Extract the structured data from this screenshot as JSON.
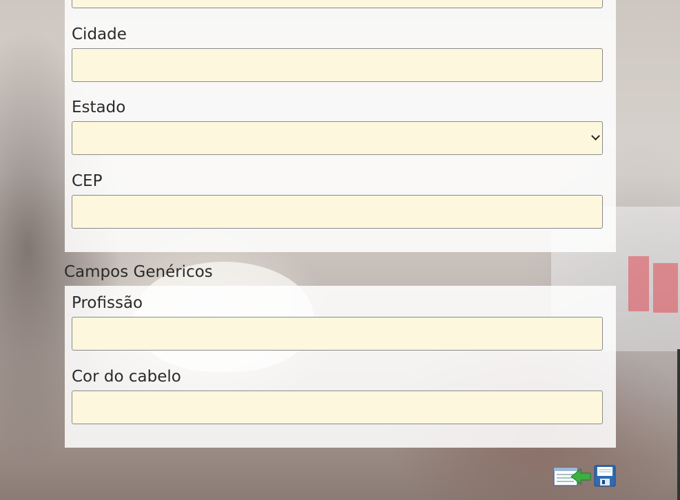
{
  "address_section": {
    "fields": {
      "cidade": {
        "label": "Cidade",
        "value": "",
        "placeholder": ""
      },
      "estado": {
        "label": "Estado",
        "value": ""
      },
      "cep": {
        "label": "CEP",
        "value": "",
        "placeholder": ""
      }
    }
  },
  "generic_section": {
    "title": "Campos Genéricos",
    "fields": {
      "profissao": {
        "label": "Profissão",
        "value": "",
        "placeholder": ""
      },
      "cor_cabelo": {
        "label": "Cor do cabelo",
        "value": "",
        "placeholder": ""
      }
    }
  },
  "actions": {
    "back_icon": "list-back-arrow-icon",
    "save_icon": "floppy-disk-icon"
  },
  "colors": {
    "field_background": "#fdf7dd",
    "back_arrow": "#3cb043",
    "save_icon_blue": "#2f6bb3"
  }
}
